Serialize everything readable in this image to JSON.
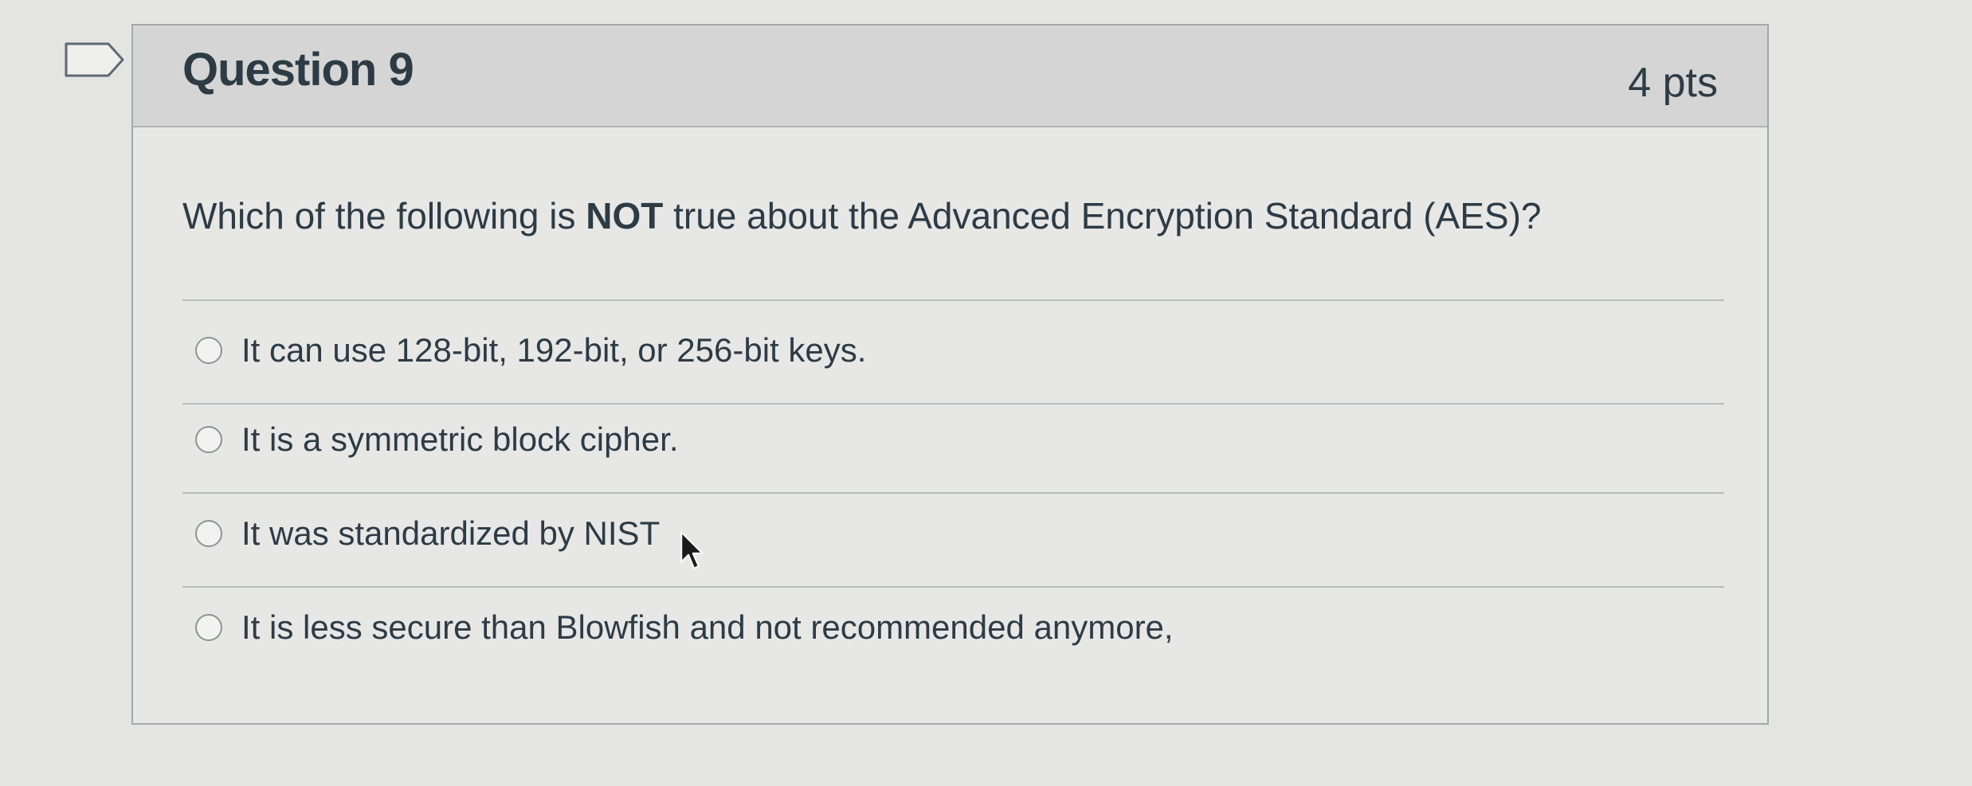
{
  "question": {
    "title": "Question 9",
    "points": "4 pts",
    "text_before": "Which of the following is ",
    "text_emphasis": "NOT",
    "text_after": " true about the Advanced Encryption Standard (AES)?"
  },
  "answers": [
    {
      "label": "It can use 128-bit, 192-bit, or 256-bit keys."
    },
    {
      "label": "It is a symmetric block cipher."
    },
    {
      "label": "It was standardized by NIST"
    },
    {
      "label": "It is less secure than Blowfish and not recommended anymore,"
    }
  ],
  "icons": {
    "flag": "flag-bookmark-icon",
    "cursor": "mouse-pointer-icon"
  },
  "colors": {
    "background": "#e4e4e3",
    "header": "#d4d5d4",
    "text": "#2d3b45",
    "border": "#a3a8ab"
  }
}
